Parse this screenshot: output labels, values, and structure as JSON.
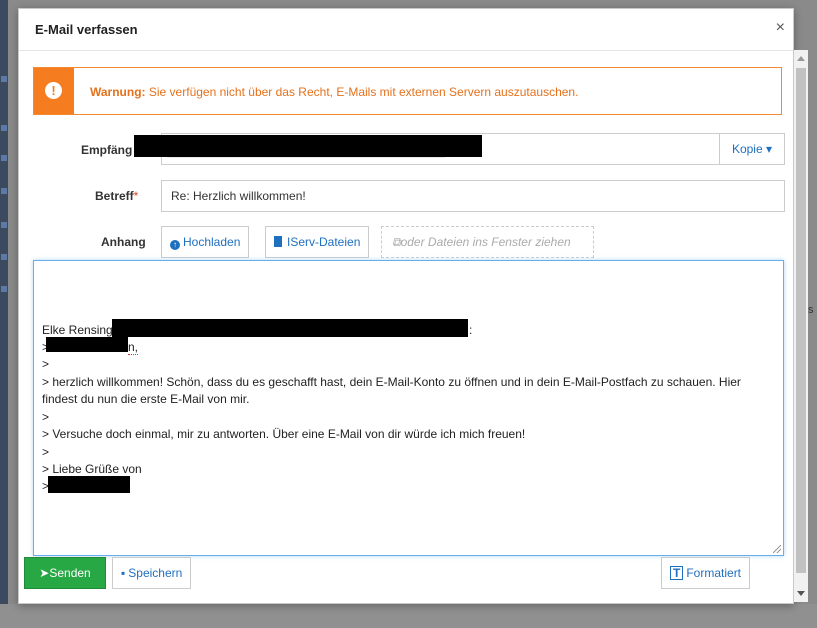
{
  "modal": {
    "title": "E-Mail verfassen",
    "close_label": "×"
  },
  "warning": {
    "label": "Warnung:",
    "message": " Sie verfügen nicht über das Recht, E-Mails mit externen Servern auszutauschen."
  },
  "form": {
    "recipient_label": "Empfäng",
    "copy_button": "Kopie",
    "subject_label": "Betreff",
    "subject_required_mark": "*",
    "subject_value": "Re: Herzlich willkommen!",
    "attachment_label": "Anhang",
    "upload_button": "Hochladen",
    "iserv_files_button": "IServ-Dateien",
    "dropzone_text": "oder Dateien ins Fenster ziehen"
  },
  "editor": {
    "lines": [
      "Elke Rensing",
      ":",
      ">",
      "n,",
      ">",
      "> herzlich willkommen! Schön, dass du es geschafft hast, dein E-Mail-Konto zu öffnen und in dein E-Mail-Postfach zu schauen. Hier",
      "findest du nun die erste E-Mail von mir.",
      ">",
      "> Versuche doch einmal, mir zu antworten. Über eine E-Mail von dir würde ich mich freuen!",
      ">",
      "> Liebe Grüße von",
      ">"
    ]
  },
  "footer": {
    "send_button": "Senden",
    "save_button": "Speichern",
    "format_button": "Formatiert"
  },
  "background": {
    "right_letter": "s"
  },
  "colors": {
    "warning_orange": "#f57c1f",
    "link_blue": "#1f6fbf",
    "send_green": "#28a745"
  }
}
